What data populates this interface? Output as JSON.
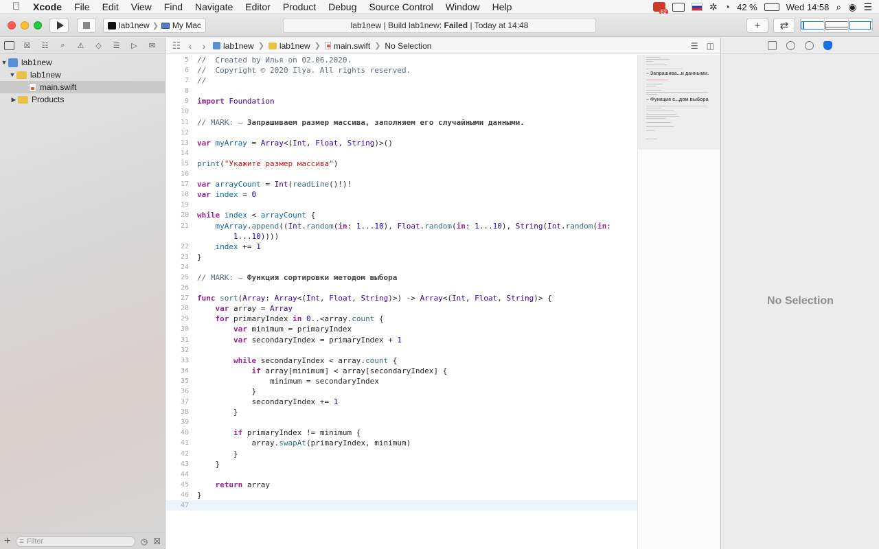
{
  "menubar": {
    "app": "Xcode",
    "items": [
      "File",
      "Edit",
      "View",
      "Find",
      "Navigate",
      "Editor",
      "Product",
      "Debug",
      "Source Control",
      "Window",
      "Help"
    ],
    "badge": "62",
    "battery": "42 %",
    "clock": "Wed 14:58"
  },
  "toolbar": {
    "scheme_target": "lab1new",
    "scheme_device": "My Mac",
    "activity_project": "lab1new",
    "activity_build": "Build lab1new:",
    "activity_status": "Failed",
    "activity_time": "Today at 14:48"
  },
  "navigator": {
    "project": "lab1new",
    "group": "lab1new",
    "file": "main.swift",
    "products": "Products",
    "filter_placeholder": "Filter"
  },
  "jumpbar": {
    "project": "lab1new",
    "group": "lab1new",
    "file": "main.swift",
    "selection": "No Selection"
  },
  "minimap": {
    "mark1": "– Запрашива...и данными.",
    "mark2": "– Функция с...дом выбора"
  },
  "inspector": {
    "no_selection": "No Selection"
  },
  "code": {
    "lines": [
      {
        "n": "5",
        "t": "//  Created by Илья on 02.06.2020."
      },
      {
        "n": "6",
        "t": "//  Copyright © 2020 Ilya. All rights reserved."
      },
      {
        "n": "7",
        "t": "//"
      },
      {
        "n": "8",
        "t": ""
      },
      {
        "n": "9",
        "t": "import Foundation"
      },
      {
        "n": "10",
        "t": ""
      },
      {
        "n": "11",
        "t": "// MARK: — Запрашиваем размер массива, заполняем его случайными данными."
      },
      {
        "n": "12",
        "t": ""
      },
      {
        "n": "13",
        "t": "var myArray = Array<(Int, Float, String)>()"
      },
      {
        "n": "14",
        "t": ""
      },
      {
        "n": "15",
        "t": "print(\"Укажите размер массива\")"
      },
      {
        "n": "16",
        "t": ""
      },
      {
        "n": "17",
        "t": "var arrayCount = Int(readLine()!)!"
      },
      {
        "n": "18",
        "t": "var index = 0"
      },
      {
        "n": "19",
        "t": ""
      },
      {
        "n": "20",
        "t": "while index < arrayCount {"
      },
      {
        "n": "21",
        "t": "    myArray.append((Int.random(in: 1...10), Float.random(in: 1...10), String(Int.random(in:"
      },
      {
        "n": "",
        "t": "        1...10))))"
      },
      {
        "n": "22",
        "t": "    index += 1"
      },
      {
        "n": "23",
        "t": "}"
      },
      {
        "n": "24",
        "t": ""
      },
      {
        "n": "25",
        "t": "// MARK: — Функция сортировки методом выбора"
      },
      {
        "n": "26",
        "t": ""
      },
      {
        "n": "27",
        "t": "func sort(Array: Array<(Int, Float, String)>) -> Array<(Int, Float, String)> {"
      },
      {
        "n": "28",
        "t": "    var array = Array"
      },
      {
        "n": "29",
        "t": "    for primaryIndex in 0..<array.count {"
      },
      {
        "n": "30",
        "t": "        var minimum = primaryIndex"
      },
      {
        "n": "31",
        "t": "        var secondaryIndex = primaryIndex + 1"
      },
      {
        "n": "32",
        "t": ""
      },
      {
        "n": "33",
        "t": "        while secondaryIndex < array.count {"
      },
      {
        "n": "34",
        "t": "            if array[minimum] < array[secondaryIndex] {"
      },
      {
        "n": "35",
        "t": "                minimum = secondaryIndex"
      },
      {
        "n": "36",
        "t": "            }"
      },
      {
        "n": "37",
        "t": "            secondaryIndex += 1"
      },
      {
        "n": "38",
        "t": "        }"
      },
      {
        "n": "39",
        "t": ""
      },
      {
        "n": "40",
        "t": "        if primaryIndex != minimum {"
      },
      {
        "n": "41",
        "t": "            array.swapAt(primaryIndex, minimum)"
      },
      {
        "n": "42",
        "t": "        }"
      },
      {
        "n": "43",
        "t": "    }"
      },
      {
        "n": "44",
        "t": ""
      },
      {
        "n": "45",
        "t": "    return array"
      },
      {
        "n": "46",
        "t": "}"
      },
      {
        "n": "47",
        "t": ""
      }
    ]
  }
}
